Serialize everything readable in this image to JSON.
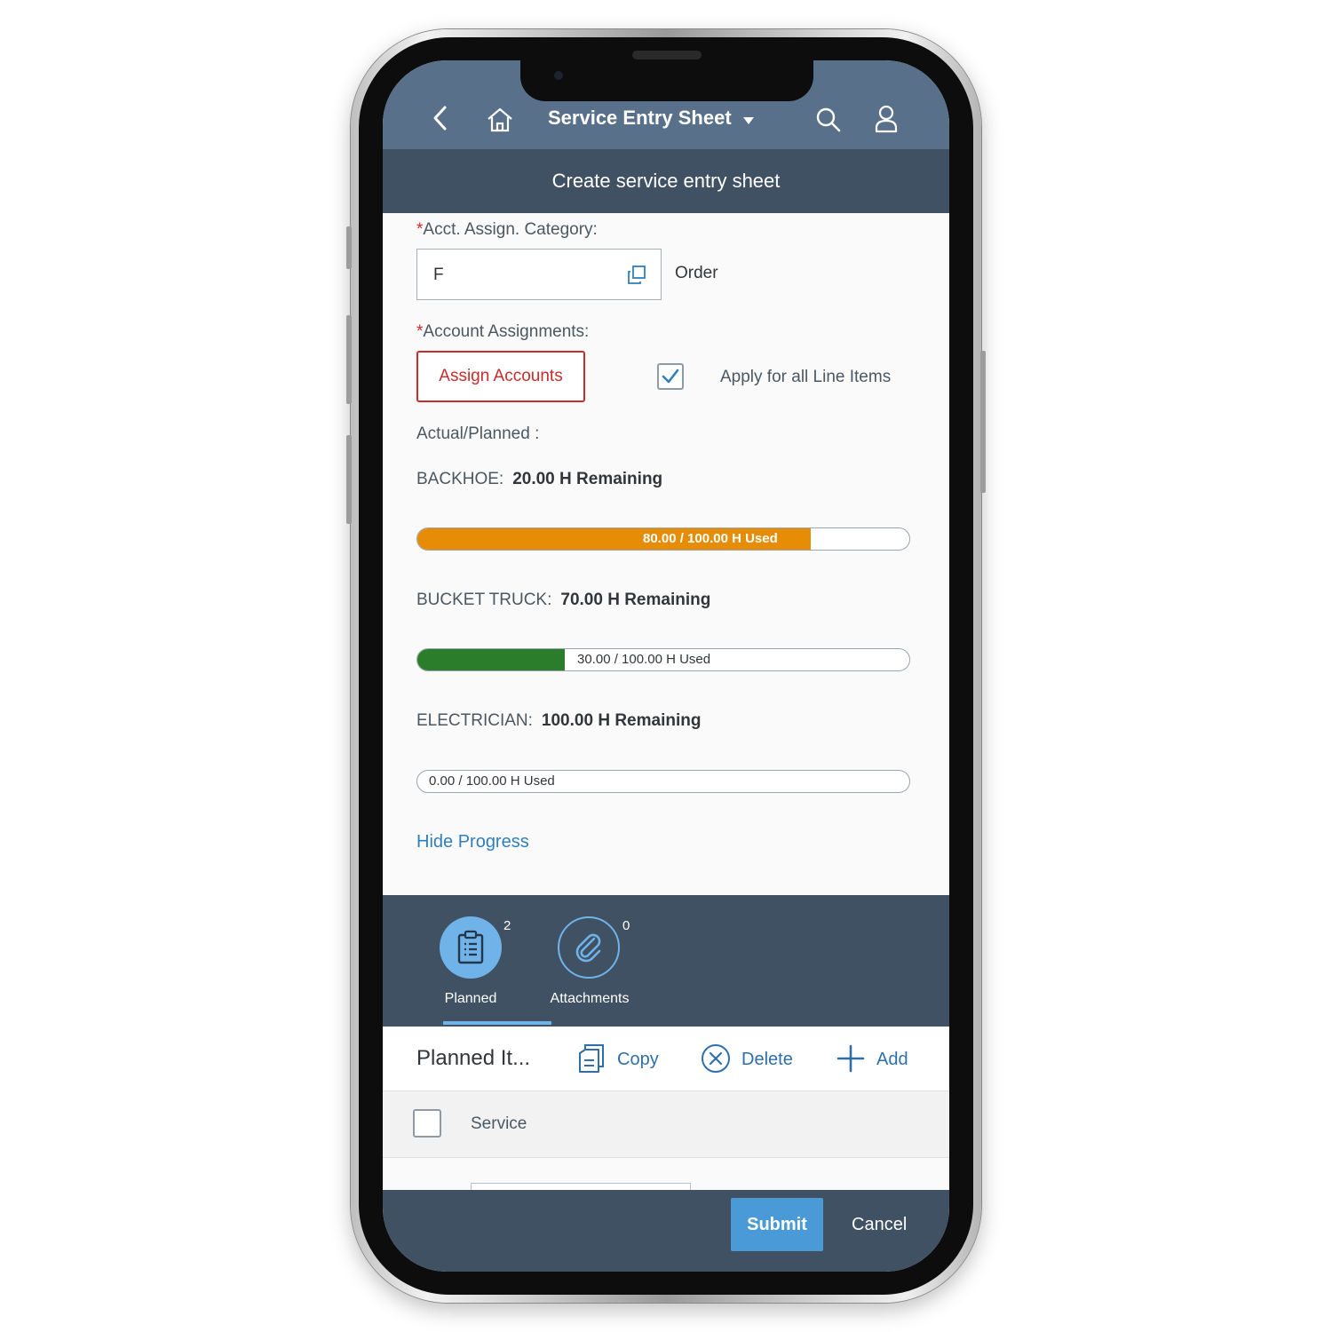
{
  "header": {
    "app_title": "Service Entry Sheet",
    "subtitle": "Create service entry sheet",
    "icons": [
      "back-icon",
      "home-icon",
      "dropdown-caret-icon",
      "search-icon",
      "user-icon"
    ]
  },
  "form": {
    "acct_category_label": "Acct. Assign. Category:",
    "acct_category_value": "F",
    "acct_category_desc": "Order",
    "required_mark": "*",
    "account_assign_label": "Account Assignments:",
    "assign_button": "Assign Accounts",
    "apply_all_label": "Apply for all Line Items",
    "apply_all_checked": true,
    "actual_planned_label": "Actual/Planned :",
    "hide_progress": "Hide Progress"
  },
  "resources": [
    {
      "name": "BACKHOE:",
      "remaining": "20.00 H Remaining",
      "used_text": "80.00 / 100.00 H Used",
      "used_fraction": 0.8,
      "color": "#e78c07"
    },
    {
      "name": "BUCKET TRUCK:",
      "remaining": "70.00 H Remaining",
      "used_text": "30.00 / 100.00 H Used",
      "used_fraction": 0.3,
      "color": "#2b7d2b"
    },
    {
      "name": "ELECTRICIAN:",
      "remaining": "100.00 H Remaining",
      "used_text": "0.00 / 100.00 H Used",
      "used_fraction": 0.0,
      "color": "#2b7d2b"
    }
  ],
  "tabs": [
    {
      "label": "Planned",
      "count": "2",
      "icon": "clipboard-icon",
      "selected": true
    },
    {
      "label": "Attachments",
      "count": "0",
      "icon": "paperclip-icon",
      "selected": false
    }
  ],
  "toolbar": {
    "title": "Planned It...",
    "copy": "Copy",
    "delete": "Delete",
    "add": "Add"
  },
  "table": {
    "column_service": "Service"
  },
  "footer": {
    "submit": "Submit",
    "cancel": "Cancel"
  },
  "colors": {
    "shell": "#58708a",
    "header_dark": "#3f5163",
    "accent_blue": "#4a9ad8",
    "error_red": "#cc2b2b"
  }
}
